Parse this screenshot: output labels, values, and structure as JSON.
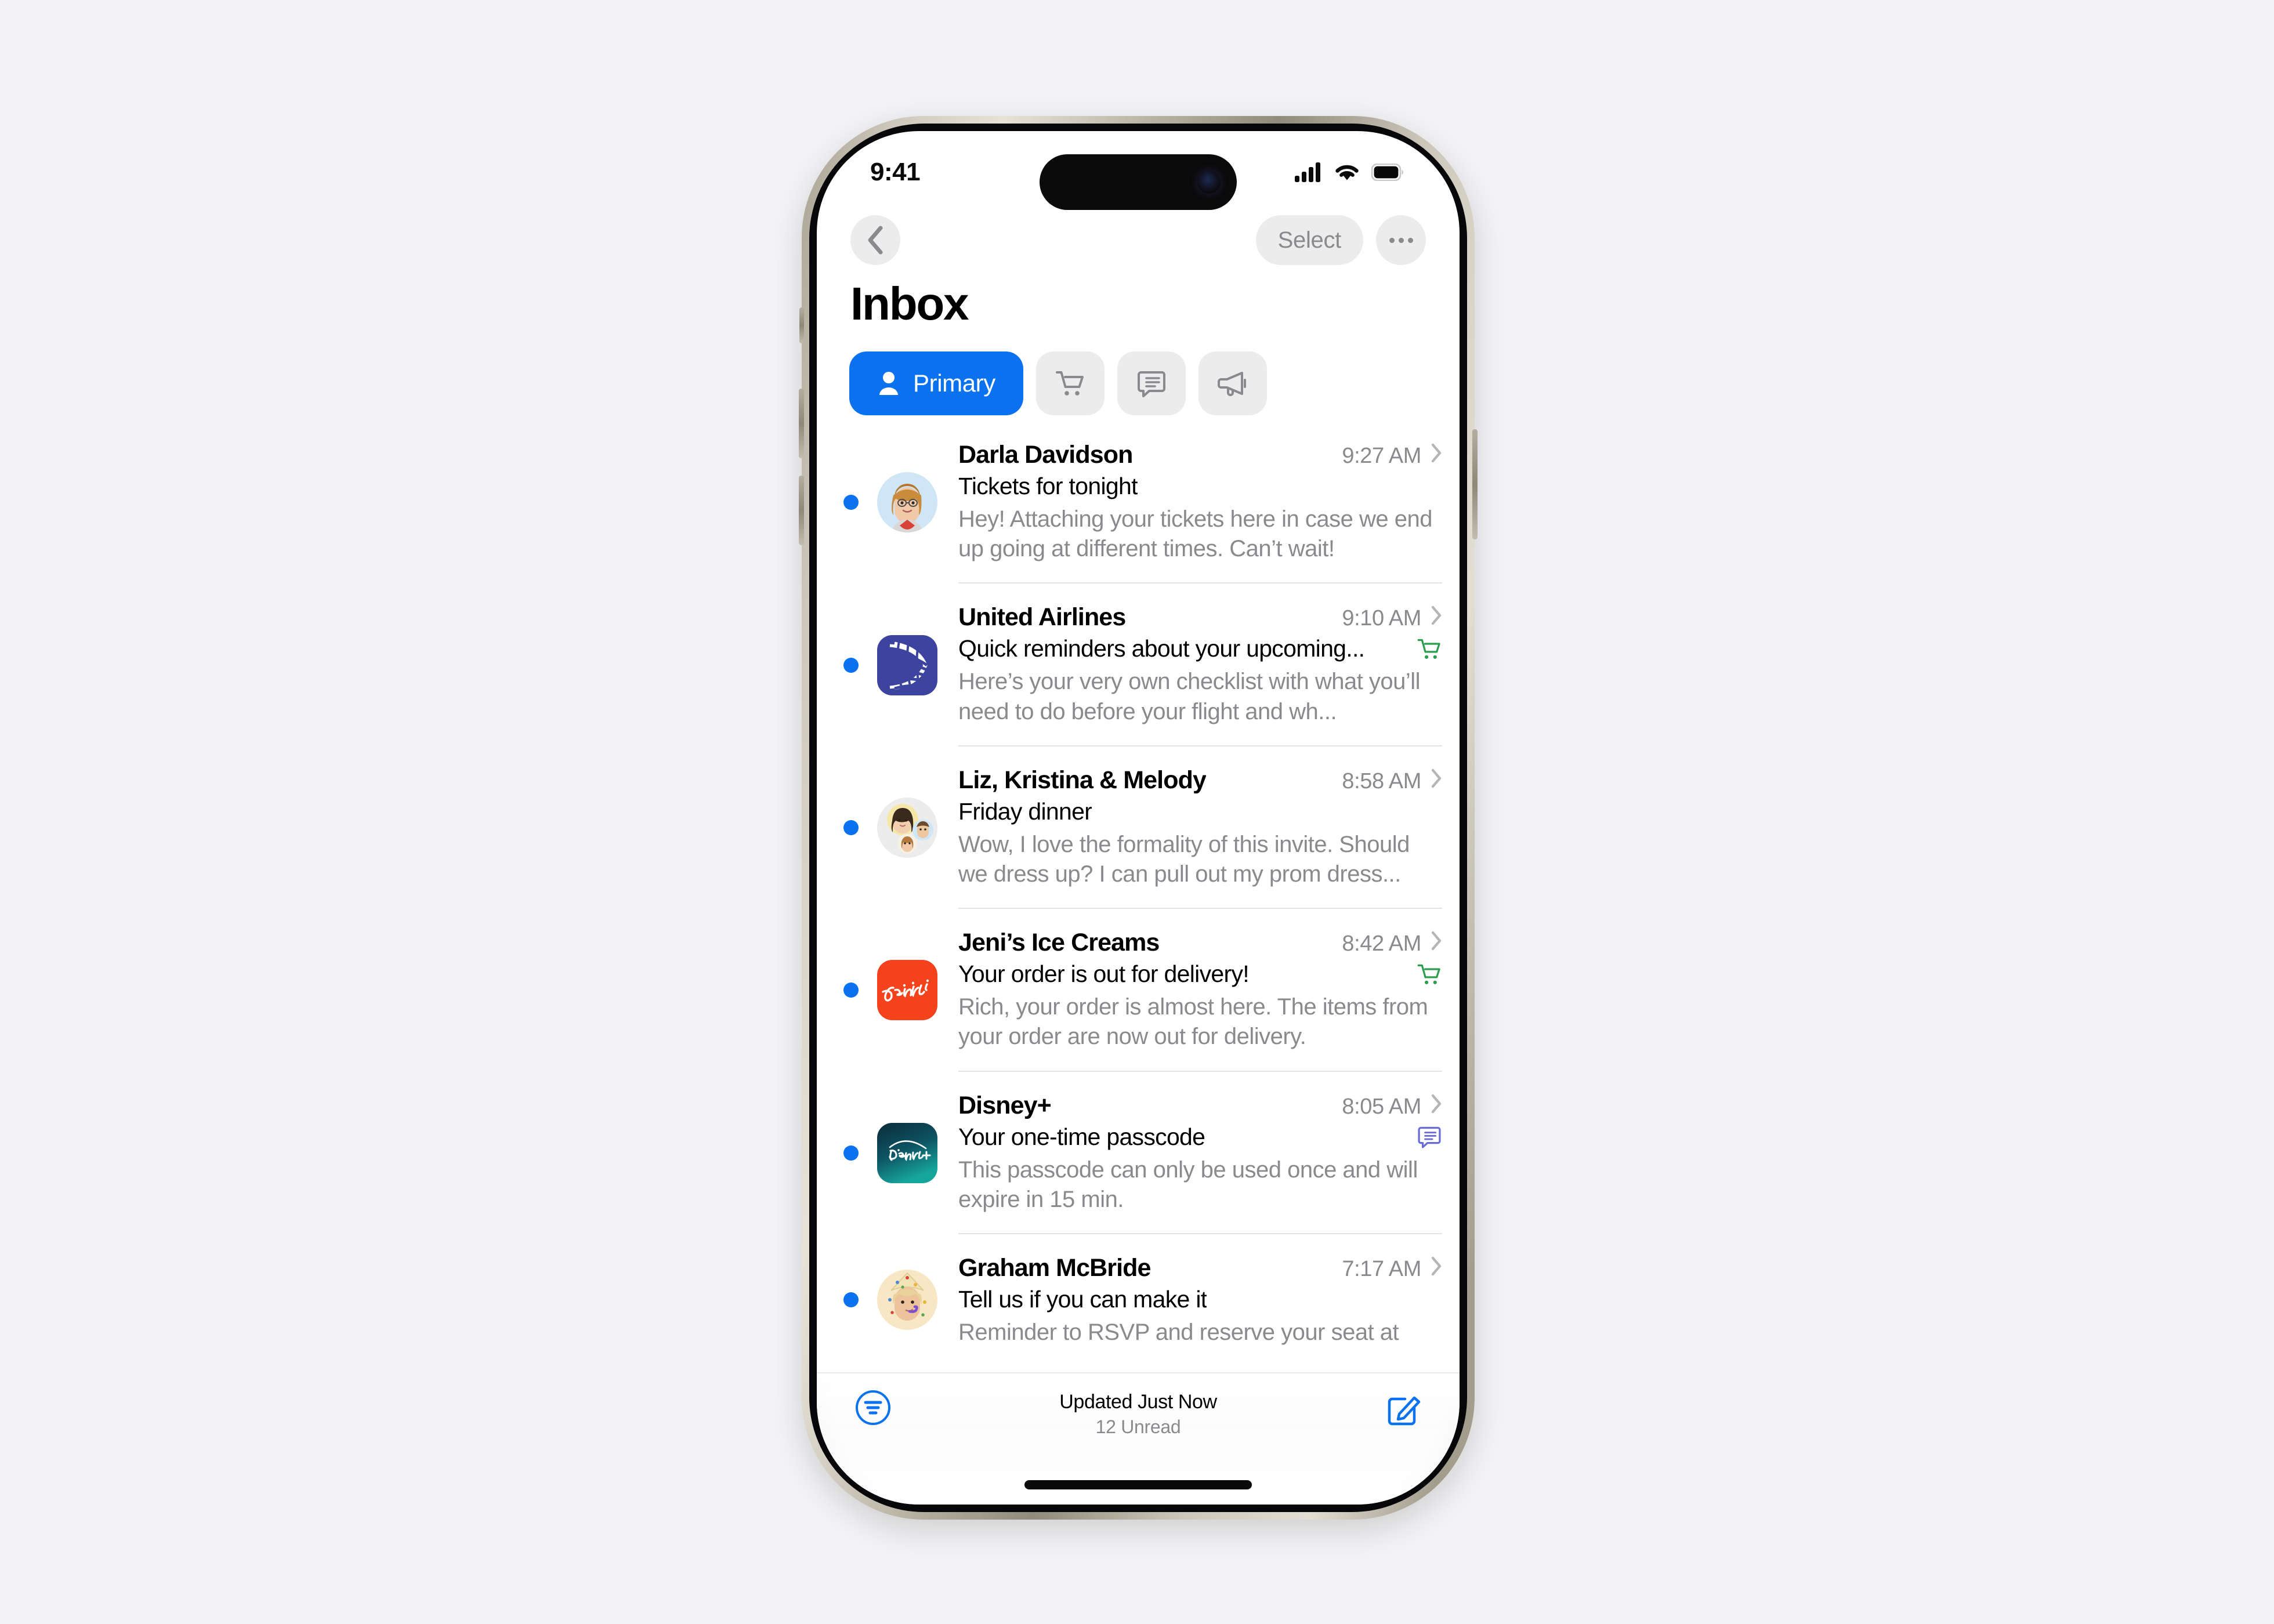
{
  "status_bar": {
    "time": "9:41",
    "icons": [
      "cellular-signal-icon",
      "wifi-icon",
      "battery-icon"
    ]
  },
  "nav": {
    "back_label": "back-chevron-icon",
    "select_label": "Select",
    "more_label": "more-options-icon"
  },
  "header": {
    "title": "Inbox"
  },
  "tabs": [
    {
      "id": "primary",
      "label": "Primary",
      "icon": "person-icon",
      "active": true
    },
    {
      "id": "transactions",
      "label": "Transactions",
      "icon": "cart-icon",
      "active": false
    },
    {
      "id": "updates",
      "label": "Updates",
      "icon": "chat-bubble-icon",
      "active": false
    },
    {
      "id": "promotions",
      "label": "Promotions",
      "icon": "megaphone-icon",
      "active": false
    }
  ],
  "emails": [
    {
      "sender": "Darla Davidson",
      "time": "9:27 AM",
      "subject": "Tickets for tonight",
      "preview": "Hey! Attaching your tickets here in case we end up going at different times. Can’t wait!",
      "unread": true,
      "avatar": "memoji-woman-glasses",
      "badge": null
    },
    {
      "sender": "United Airlines",
      "time": "9:10 AM",
      "subject": "Quick reminders about your upcoming...",
      "preview": "Here’s your very own checklist with what you’ll need to do before your flight and wh...",
      "unread": true,
      "avatar": "united-airlines-logo",
      "badge": "cart-icon"
    },
    {
      "sender": "Liz, Kristina & Melody",
      "time": "8:58 AM",
      "subject": "Friday dinner",
      "preview": "Wow, I love the formality of this invite. Should we dress up? I can pull out my prom dress...",
      "unread": true,
      "avatar": "memoji-group",
      "badge": null
    },
    {
      "sender": "Jeni’s Ice Creams",
      "time": "8:42 AM",
      "subject": "Your order is out for delivery!",
      "preview": "Rich, your order is almost here. The items from your order are now out for delivery.",
      "unread": true,
      "avatar": "jenis-ice-creams-logo",
      "badge": "cart-icon"
    },
    {
      "sender": "Disney+",
      "time": "8:05 AM",
      "subject": "Your one-time passcode",
      "preview": "This passcode can only be used once and will expire in 15 min.",
      "unread": true,
      "avatar": "disney-plus-logo",
      "badge": "chat-bubble-icon"
    },
    {
      "sender": "Graham McBride",
      "time": "7:17 AM",
      "subject": "Tell us if you can make it",
      "preview": "Reminder to RSVP and reserve your seat at",
      "unread": true,
      "avatar": "memoji-party-hat",
      "badge": null
    }
  ],
  "toolbar": {
    "filter_icon": "filter-icon",
    "updated_text": "Updated Just Now",
    "unread_text": "12 Unread",
    "compose_icon": "compose-icon"
  },
  "colors": {
    "accent_blue": "#0a72ef",
    "badge_green": "#2a9d4e",
    "badge_purple": "#6b6bd6",
    "secondary_text": "#8a8a8e",
    "chip_gray": "#ececed",
    "page_background": "#f4f4f6"
  }
}
